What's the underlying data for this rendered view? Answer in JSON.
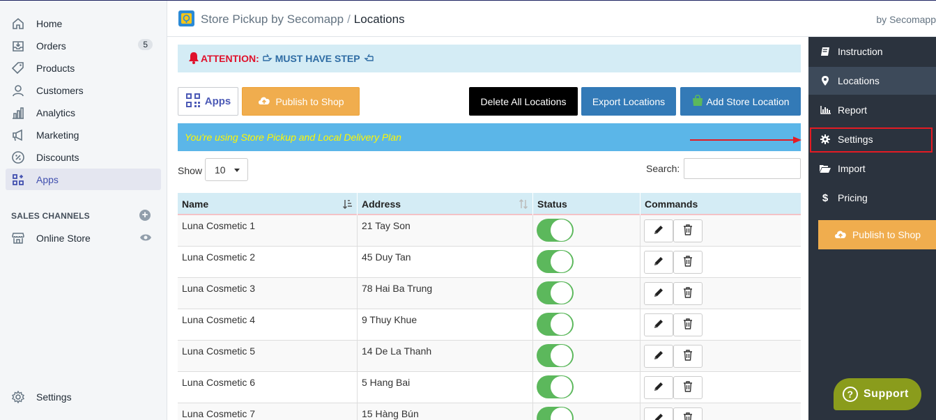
{
  "leftnav": {
    "items": [
      {
        "label": "Home",
        "icon": "home-icon"
      },
      {
        "label": "Orders",
        "icon": "orders-icon",
        "badge": "5"
      },
      {
        "label": "Products",
        "icon": "tag-icon"
      },
      {
        "label": "Customers",
        "icon": "person-icon"
      },
      {
        "label": "Analytics",
        "icon": "bar-chart-icon"
      },
      {
        "label": "Marketing",
        "icon": "megaphone-icon"
      },
      {
        "label": "Discounts",
        "icon": "discount-icon"
      },
      {
        "label": "Apps",
        "icon": "apps-icon",
        "active": true
      }
    ],
    "sales_channels_title": "SALES CHANNELS",
    "online_store": "Online Store",
    "settings": "Settings"
  },
  "header": {
    "app_name": "Store Pickup by Secomapp",
    "separator": "/",
    "page": "Locations",
    "by": "by Secomapp"
  },
  "main": {
    "attention_label": "ATTENTION:",
    "attention_text": "MUST HAVE STEP",
    "apps_button": "Apps",
    "publish_button": "Publish to Shop",
    "delete_button": "Delete All Locations",
    "export_button": "Export Locations",
    "add_button": "Add Store Location",
    "plan_text": "You're using Store Pickup and Local Delivery Plan",
    "show_label": "Show",
    "show_value": "10",
    "search_label": "Search:",
    "search_value": ""
  },
  "table": {
    "headers": [
      "Name",
      "Address",
      "Status",
      "Commands"
    ],
    "rows": [
      {
        "name": "Luna Cosmetic 1",
        "address": "21 Tay Son",
        "status": true
      },
      {
        "name": "Luna Cosmetic 2",
        "address": "45 Duy Tan",
        "status": true
      },
      {
        "name": "Luna Cosmetic 3",
        "address": "78 Hai Ba Trung",
        "status": true
      },
      {
        "name": "Luna Cosmetic 4",
        "address": "9 Thuy Khue",
        "status": true
      },
      {
        "name": "Luna Cosmetic 5",
        "address": "14 De La Thanh",
        "status": true
      },
      {
        "name": "Luna Cosmetic 6",
        "address": "5 Hang Bai",
        "status": true
      },
      {
        "name": "Luna Cosmetic 7",
        "address": "15 Hàng Bún",
        "status": true
      }
    ]
  },
  "rightnav": {
    "items": [
      {
        "label": "Instruction",
        "icon": "book-icon"
      },
      {
        "label": "Locations",
        "icon": "map-marker-icon",
        "active": true
      },
      {
        "label": "Report",
        "icon": "bar-chart-icon"
      },
      {
        "label": "Settings",
        "icon": "gear-icon"
      },
      {
        "label": "Import",
        "icon": "folder-open-icon"
      },
      {
        "label": "Pricing",
        "icon": "dollar-icon"
      }
    ],
    "publish_button": "Publish to Shop"
  },
  "support": {
    "label": "Support"
  },
  "colors": {
    "accent": "#3f4eae",
    "publish": "#f0ad4e",
    "primary_blue": "#337ab7",
    "plan_bar": "#5bb6e8",
    "plan_text": "#fff700",
    "toggle_on": "#5cb85c",
    "right_panel": "#2b333e",
    "highlight": "#e41b23",
    "support": "#8a9c1c"
  }
}
